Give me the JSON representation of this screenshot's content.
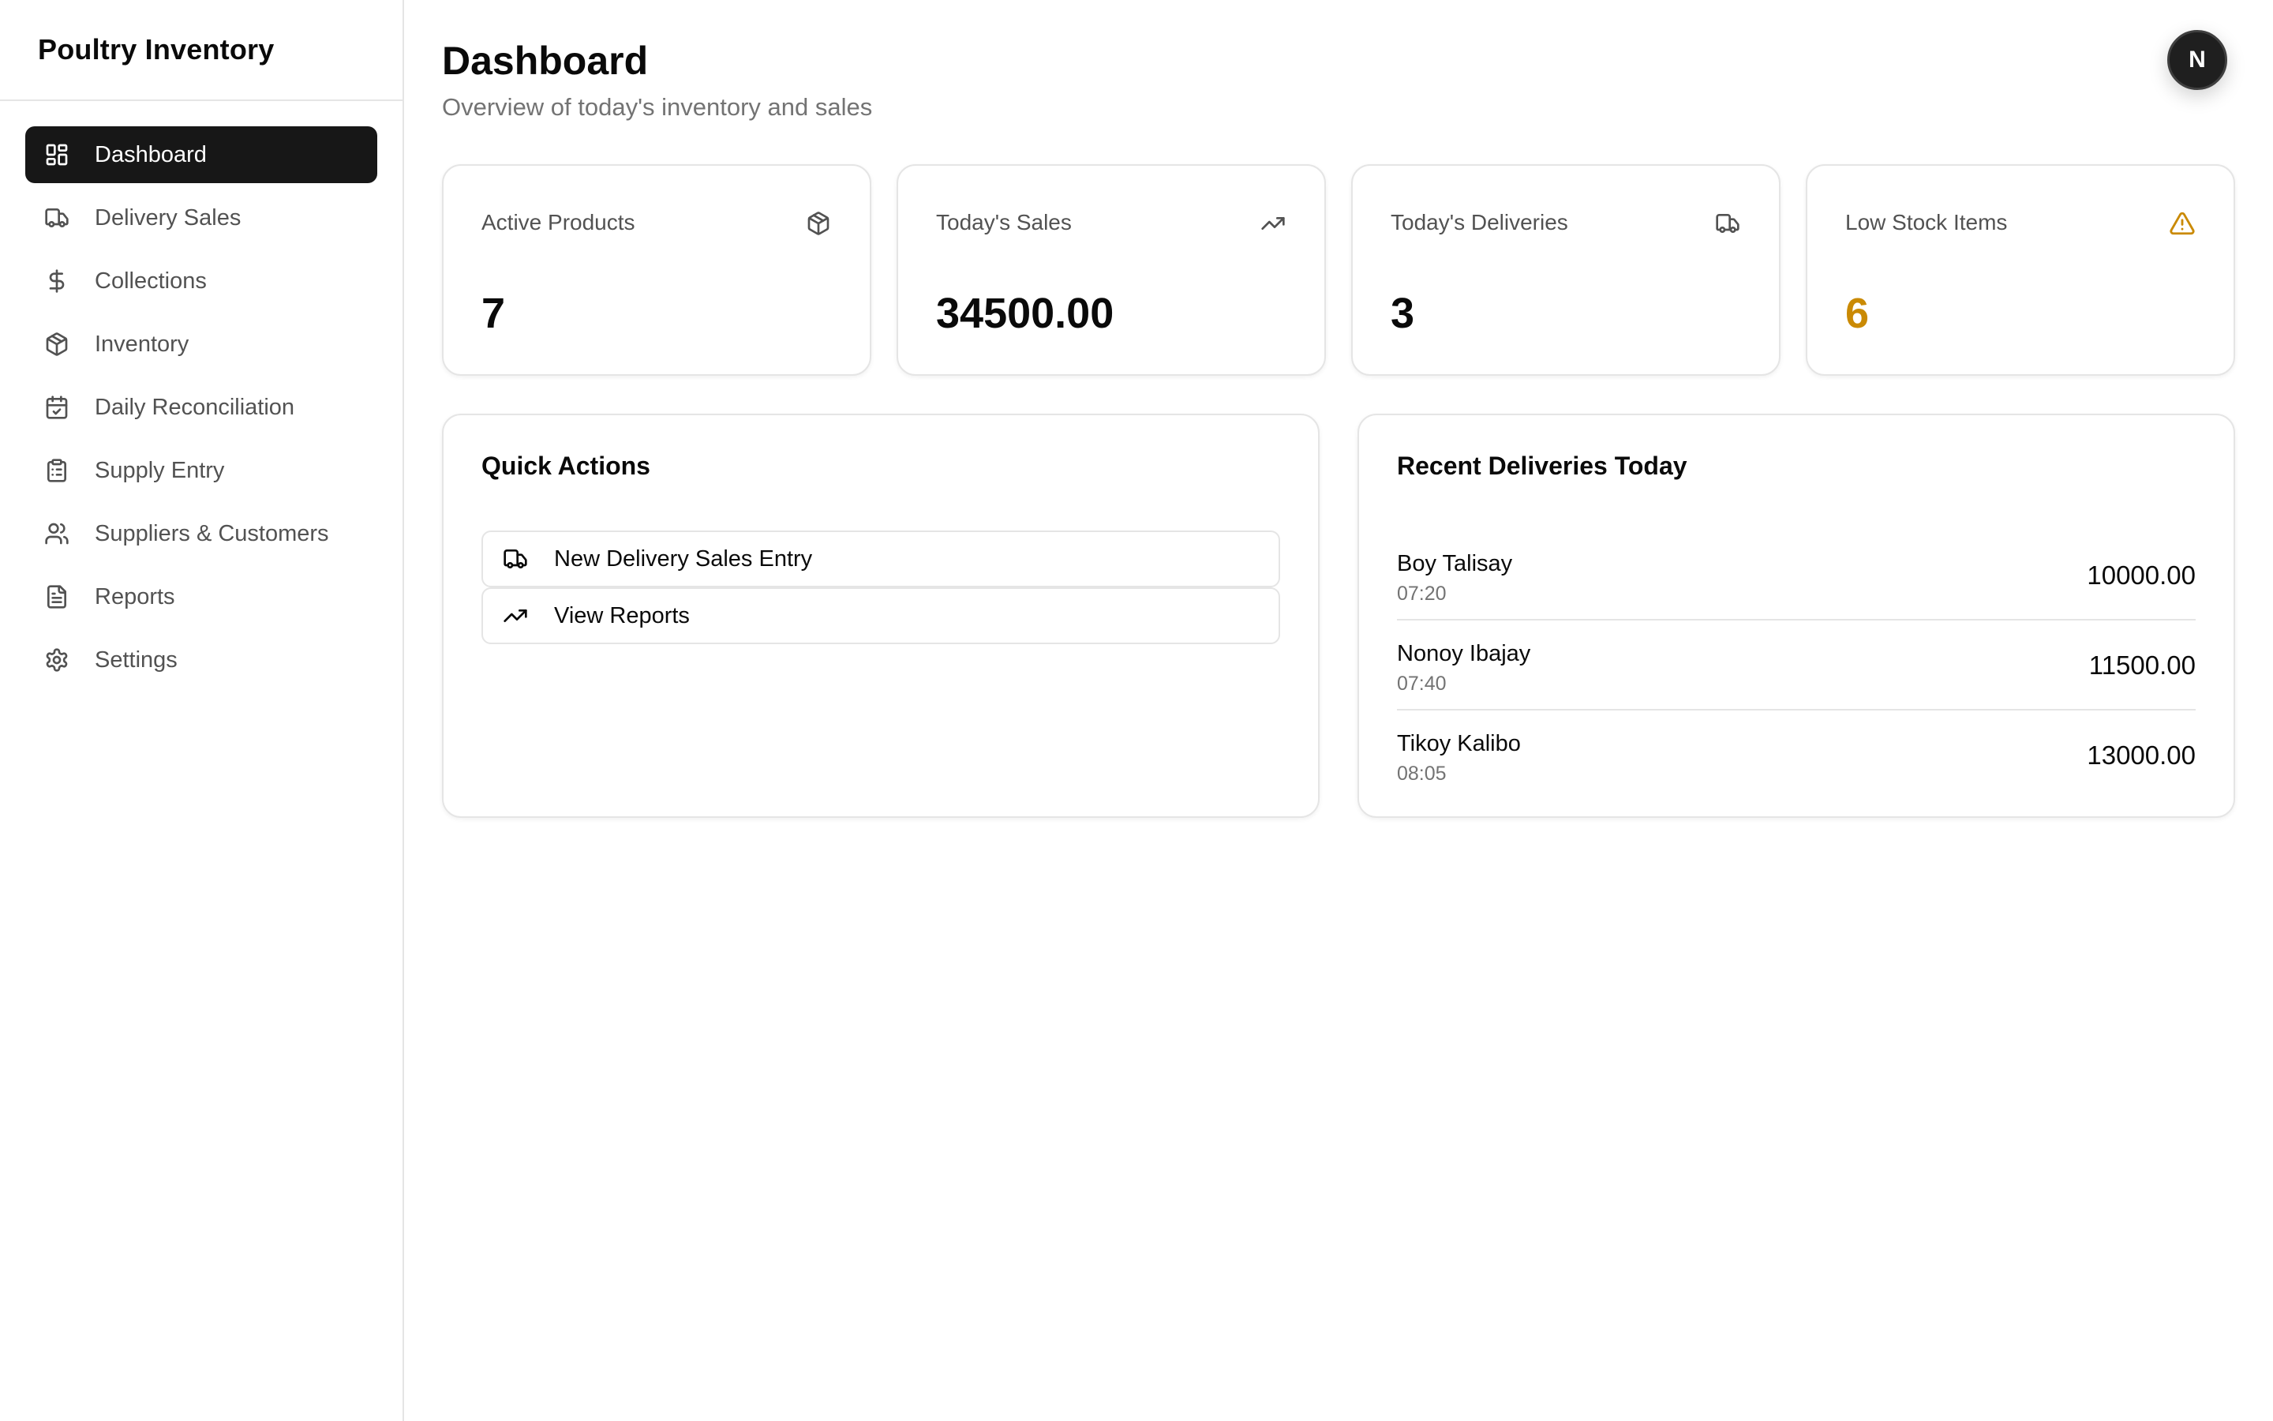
{
  "app": {
    "title": "Poultry Inventory"
  },
  "sidebar": {
    "items": [
      {
        "label": "Dashboard",
        "icon": "dashboard-icon",
        "active": true
      },
      {
        "label": "Delivery Sales",
        "icon": "truck-icon"
      },
      {
        "label": "Collections",
        "icon": "dollar-icon"
      },
      {
        "label": "Inventory",
        "icon": "package-icon"
      },
      {
        "label": "Daily Reconciliation",
        "icon": "calendar-check-icon"
      },
      {
        "label": "Supply Entry",
        "icon": "clipboard-icon"
      },
      {
        "label": "Suppliers & Customers",
        "icon": "users-icon"
      },
      {
        "label": "Reports",
        "icon": "file-text-icon"
      },
      {
        "label": "Settings",
        "icon": "gear-icon"
      }
    ]
  },
  "header": {
    "title": "Dashboard",
    "subtitle": "Overview of today's inventory and sales",
    "avatar_initial": "N"
  },
  "stats": [
    {
      "label": "Active Products",
      "value": "7",
      "icon": "package-icon"
    },
    {
      "label": "Today's Sales",
      "value": "34500.00",
      "icon": "trending-up-icon"
    },
    {
      "label": "Today's Deliveries",
      "value": "3",
      "icon": "truck-icon"
    },
    {
      "label": "Low Stock Items",
      "value": "6",
      "icon": "warning-icon"
    }
  ],
  "colors": {
    "accent_dark": "#171717",
    "warning": "#ca8a04",
    "border": "#e5e5e5",
    "muted": "#737373"
  },
  "quick_actions": {
    "title": "Quick Actions",
    "items": [
      {
        "label": "New Delivery Sales Entry",
        "icon": "truck-icon"
      },
      {
        "label": "View Reports",
        "icon": "trending-up-icon"
      }
    ]
  },
  "recent_deliveries": {
    "title": "Recent Deliveries Today",
    "rows": [
      {
        "name": "Boy Talisay",
        "time": "07:20",
        "amount": "10000.00"
      },
      {
        "name": "Nonoy Ibajay",
        "time": "07:40",
        "amount": "11500.00"
      },
      {
        "name": "Tikoy Kalibo",
        "time": "08:05",
        "amount": "13000.00"
      }
    ]
  }
}
